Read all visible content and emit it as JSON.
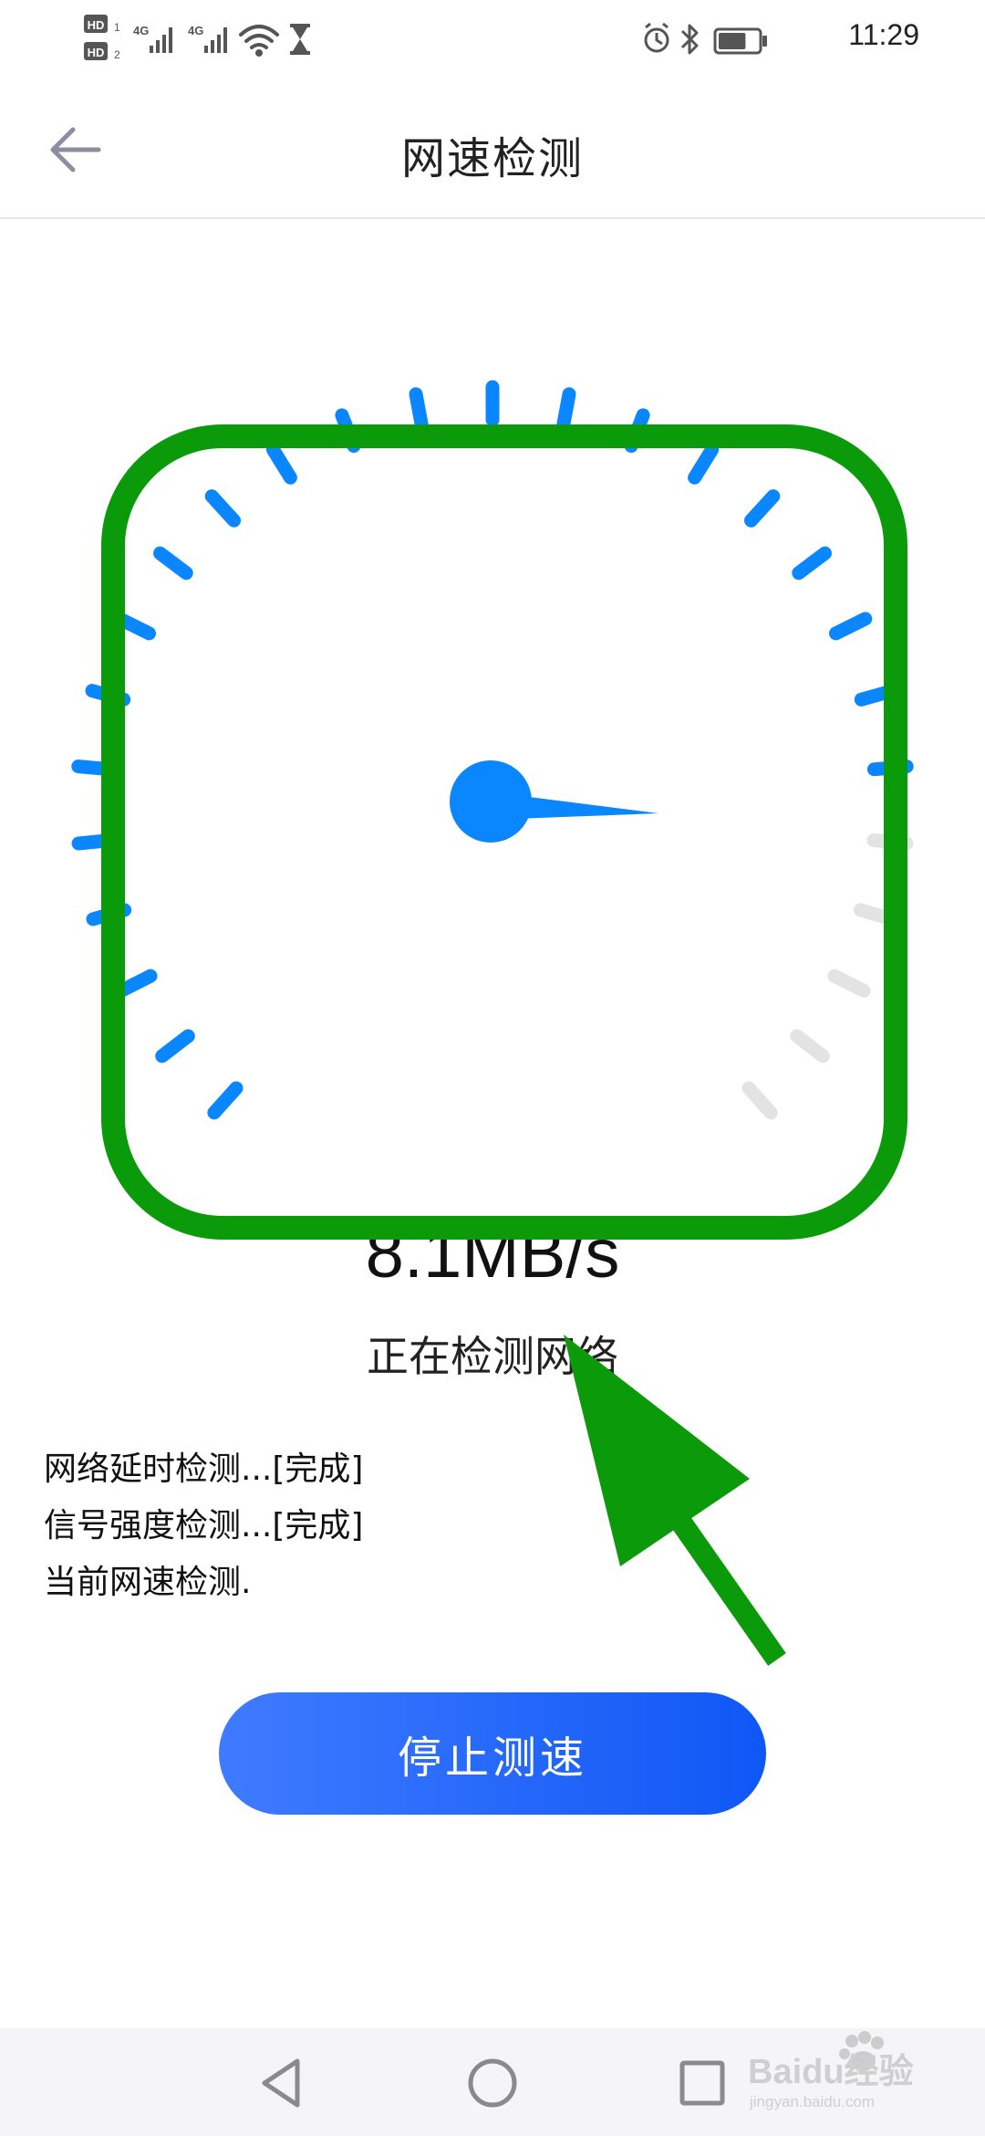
{
  "status_bar": {
    "time": "11:29",
    "icons": [
      "hd-sim1-icon",
      "hd-sim2-icon",
      "signal-4g-icon",
      "signal-4g-icon",
      "wifi-icon",
      "hourglass-icon",
      "alarm-icon",
      "bluetooth-icon",
      "battery-icon"
    ],
    "battery_level": 0.7
  },
  "app_bar": {
    "title": "网速检测",
    "back_icon": "arrow-left-icon"
  },
  "gauge": {
    "tick_count": 27,
    "active_ticks": 22,
    "active_color": "#0a87ff",
    "inactive_color": "#e3e3e3",
    "needle_color": "#0a87ff"
  },
  "speed": {
    "value": "8.1MB/s",
    "status": "正在检测网络"
  },
  "log": {
    "items": [
      "网络延时检测...[完成]",
      "信号强度检测...[完成]",
      "当前网速检测."
    ]
  },
  "actions": {
    "stop_label": "停止测速"
  },
  "annotation": {
    "color": "#0a9a0a"
  },
  "nav_bar": {
    "icons": [
      "back-triangle-icon",
      "home-circle-icon",
      "recents-square-icon"
    ]
  },
  "watermark": {
    "text": "Baidu经验",
    "subtext": "jingyan.baidu.com"
  }
}
